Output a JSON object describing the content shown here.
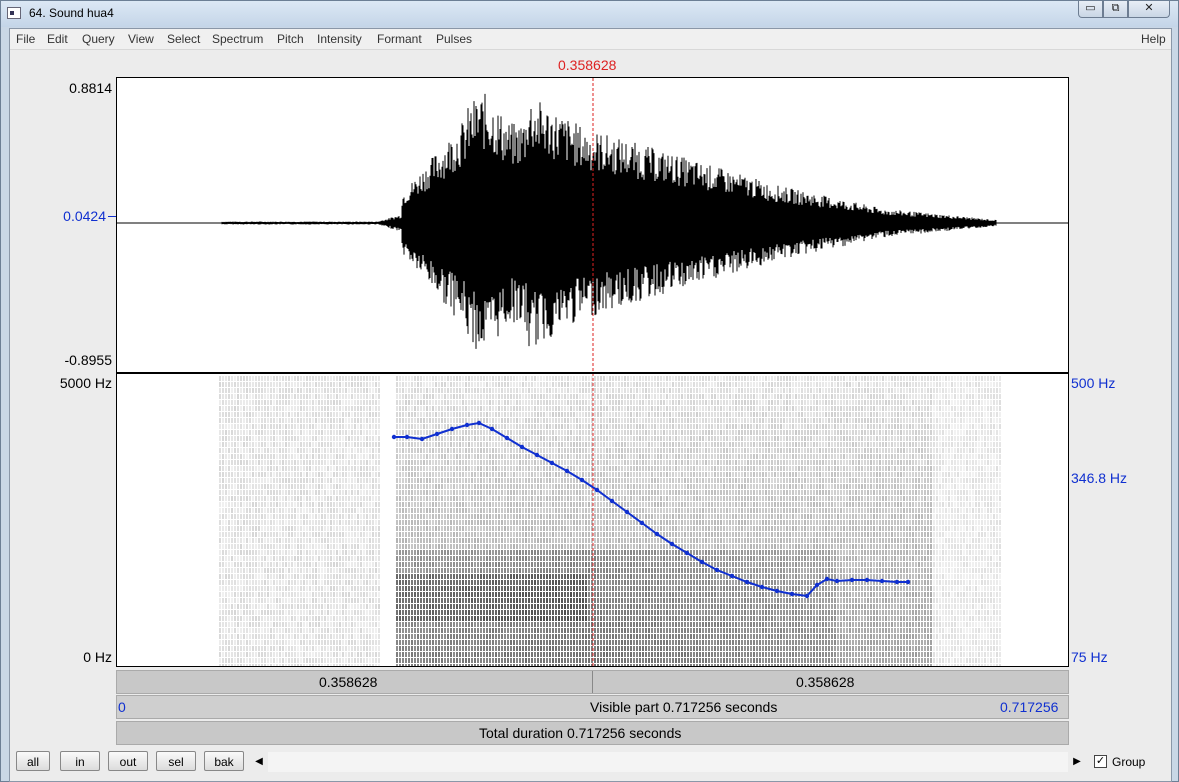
{
  "window": {
    "title": "64. Sound hua4",
    "buttons": [
      "▭",
      "⧉",
      "✕"
    ]
  },
  "menu": {
    "items": [
      "File",
      "Edit",
      "Query",
      "View",
      "Select",
      "Spectrum",
      "Pitch",
      "Intensity",
      "Formant",
      "Pulses"
    ],
    "help": "Help"
  },
  "cursor": {
    "time_label": "0.358628"
  },
  "waveform": {
    "y_max": "0.8814",
    "y_mid": "0.0424",
    "y_min": "-0.8955"
  },
  "spectrogram": {
    "freq_max": "5000 Hz",
    "freq_min": "0 Hz",
    "pitch_max": "500 Hz",
    "pitch_mid": "346.8 Hz",
    "pitch_min": "75 Hz"
  },
  "time_rows": {
    "left_segment": "0.358628",
    "right_segment": "0.358628",
    "visible_start": "0",
    "visible_label": "Visible part 0.717256 seconds",
    "visible_end": "0.717256",
    "total_label": "Total duration 0.717256 seconds"
  },
  "bottom": {
    "buttons": [
      "all",
      "in",
      "out",
      "sel",
      "bak"
    ],
    "scroll_left": "◀",
    "scroll_right": "▶",
    "group_checked": "✓",
    "group_label": "Group"
  },
  "colors": {
    "cursor": "#dd2222",
    "pitch": "#1030d0",
    "axis_blue": "#1030d0"
  }
}
